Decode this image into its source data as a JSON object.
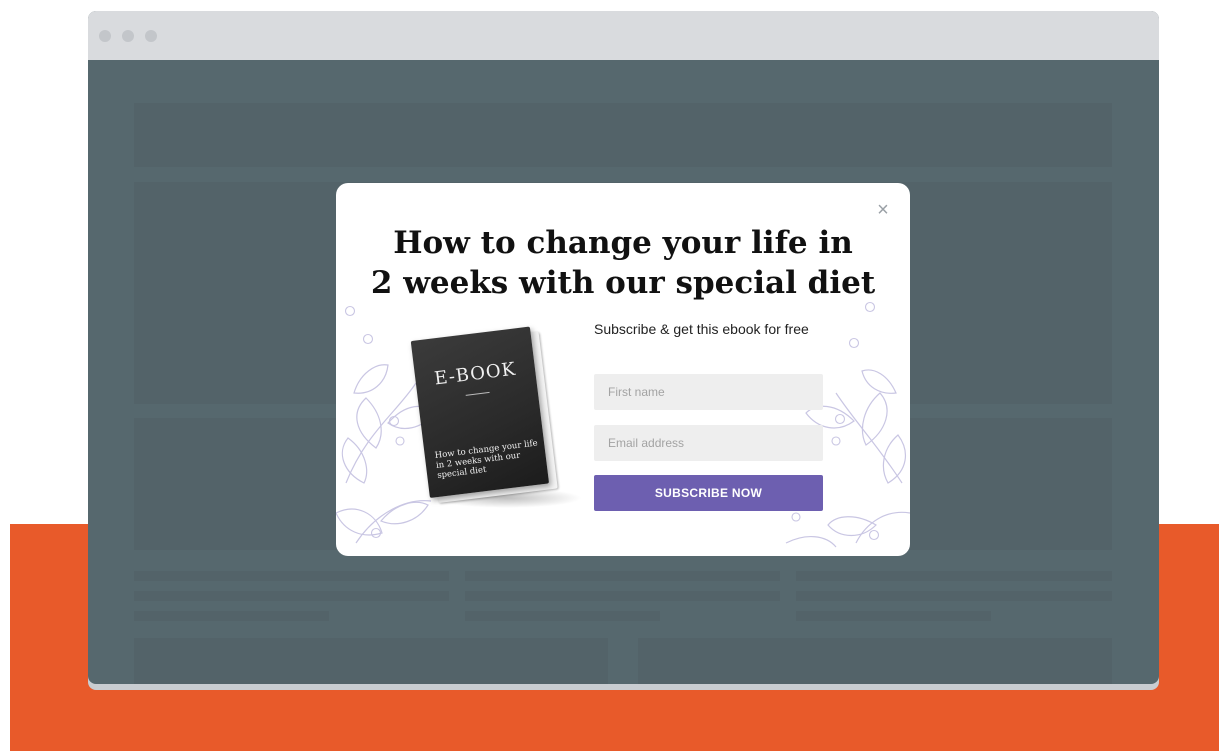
{
  "popup": {
    "title_line1": "How to change your life in",
    "title_line2": "2 weeks with our special diet",
    "subtitle": "Subscribe & get this ebook for free",
    "first_name_placeholder": "First name",
    "email_placeholder": "Email address",
    "subscribe_label": "SUBSCRIBE NOW",
    "close_label": "×"
  },
  "book": {
    "cover_title": "E-BOOK",
    "cover_text": "How to change your life in 2 weeks with our special diet"
  },
  "colors": {
    "accent_button": "#6d5fb0",
    "orange_band": "#e85a2a",
    "page_backdrop": "#56686e",
    "titlebar": "#d9dbde"
  }
}
